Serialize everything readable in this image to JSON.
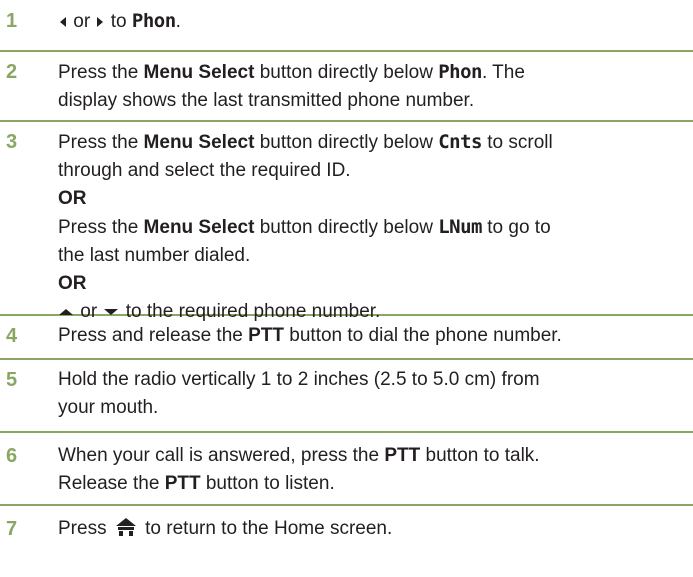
{
  "colors": {
    "accent": "#8aa663",
    "text": "#231f20"
  },
  "steps": [
    {
      "num": "1",
      "l1_icon1": "left-arrow-key-icon",
      "l1_or": "or",
      "l1_icon2": "right-arrow-key-icon",
      "l1_to": "to",
      "l1_display": "Phon",
      "l1_end": "."
    },
    {
      "num": "2",
      "l1_a": "Press the",
      "l1_b": "Menu Select",
      "l1_c": "button directly below",
      "l1_disp": "Phon",
      "l1_d": ". The",
      "l2": "display shows the last transmitted phone number."
    },
    {
      "num": "3",
      "l1_a": "Press the",
      "l1_b": "Menu Select",
      "l1_c": "button directly below",
      "l1_disp": "Cnts",
      "l1_d": "to scroll",
      "l2": "through and select the required ID.",
      "or1": "OR",
      "l3_a": "Press the",
      "l3_b": "Menu Select",
      "l3_c": "button directly below",
      "l3_disp": "LNum",
      "l3_d": "to go to",
      "l4": "the last number dialed.",
      "or2": "OR",
      "l5_or": "or",
      "l5_text": "to the required phone number."
    },
    {
      "num": "4",
      "l1_a": "Press and release the",
      "l1_b": "PTT",
      "l1_c": "button to dial the phone number."
    },
    {
      "num": "5",
      "l1": "Hold the radio vertically 1 to 2 inches (2.5 to 5.0 cm) from",
      "l2": "your mouth."
    },
    {
      "num": "6",
      "l1_a": "When your call is answered, press the",
      "l1_b": "PTT",
      "l1_c": "button to talk.",
      "l2_a": "Release the",
      "l2_b": "PTT",
      "l2_c": "button to listen."
    },
    {
      "num": "7",
      "l1_a": "Press",
      "l1_icon": "home-button-icon",
      "l1_b": "to return to the Home screen."
    }
  ]
}
